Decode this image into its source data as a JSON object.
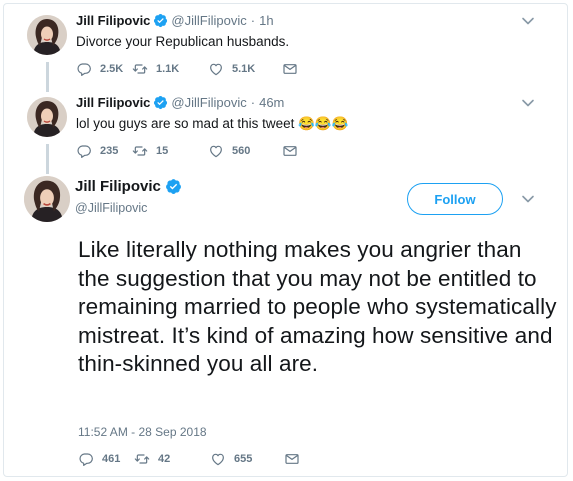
{
  "colors": {
    "verified": "#1da1f2",
    "muted": "#657786",
    "text": "#14171a",
    "thread": "#ccd6dd"
  },
  "tweets": [
    {
      "name": "Jill Filipovic",
      "handle": "@JillFilipovic",
      "separator": "·",
      "time": "1h",
      "text": "Divorce your Republican husbands.",
      "replies": "2.5K",
      "retweets": "1.1K",
      "likes": "5.1K"
    },
    {
      "name": "Jill Filipovic",
      "handle": "@JillFilipovic",
      "separator": "·",
      "time": "46m",
      "text": "lol you guys are so mad at this tweet 😂😂😂",
      "replies": "235",
      "retweets": "15",
      "likes": "560"
    }
  ],
  "main": {
    "name": "Jill Filipovic",
    "handle": "@JillFilipovic",
    "follow_label": "Follow",
    "text": "Like literally nothing makes you angrier than the suggestion that you may not be entitled to remaining married to people who systematically mistreat. It’s kind of amazing how sensitive and thin-skinned you all are.",
    "timestamp": "11:52 AM - 28 Sep 2018",
    "replies": "461",
    "retweets": "42",
    "likes": "655"
  },
  "icons": {
    "verified": "verified-badge-icon",
    "reply": "reply-icon",
    "retweet": "retweet-icon",
    "like": "heart-icon",
    "dm": "envelope-icon",
    "menu": "chevron-down-icon"
  }
}
